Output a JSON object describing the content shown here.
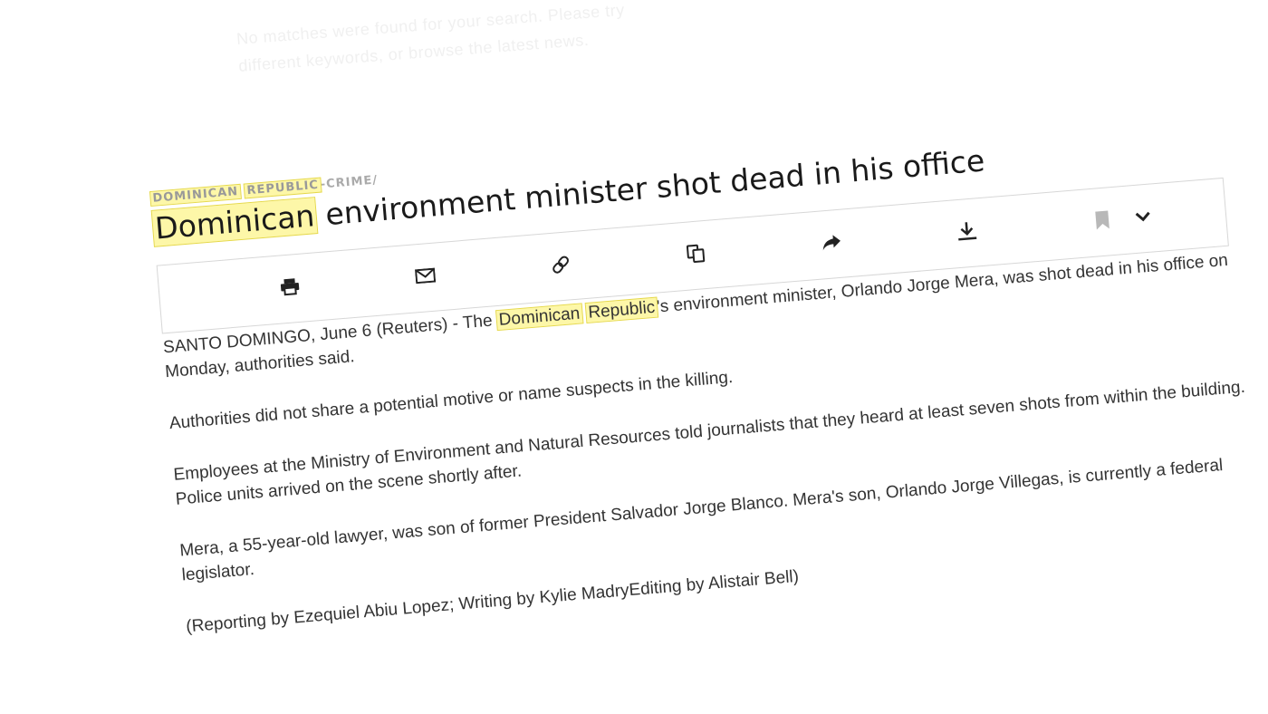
{
  "background_text": [
    "No matches were found for your search. Please try",
    "different keywords, or browse the latest news."
  ],
  "breadcrumb": {
    "part1": "DOMINICAN",
    "part2": "REPUBLIC",
    "rest": "-CRIME/"
  },
  "headline": {
    "highlighted": "Dominican",
    "rest": " environment minister shot dead in his office"
  },
  "toolbar": {
    "icons": [
      "print-icon",
      "mail-icon",
      "link-icon",
      "copy-icon",
      "share-icon",
      "download-icon",
      "bookmark-icon",
      "chevron-down-icon"
    ]
  },
  "article": {
    "lead_prefix": "SANTO DOMINGO, June 6 (Reuters) - The ",
    "lead_hl1": "Dominican",
    "lead_hl2": "Republic",
    "lead_suffix": "'s environment minister, Orlando Jorge Mera, was shot dead in his office on Monday, authorities said.",
    "p2": "Authorities did not share a potential motive or name suspects in the killing.",
    "p3": "Employees at the Ministry of Environment and Natural Resources told journalists that they heard at least seven shots from within the building. Police units arrived on the scene shortly after.",
    "p4": "Mera, a 55-year-old lawyer, was son of former President Salvador Jorge Blanco. Mera's son, Orlando Jorge Villegas, is currently a federal legislator.",
    "p5": "(Reporting by Ezequiel Abiu Lopez; Writing by Kylie MadryEditing by Alistair Bell)"
  },
  "colors": {
    "highlight_bg": "#fdf7a8",
    "highlight_border": "#e6d94a",
    "text": "#333333",
    "breadcrumb": "#aaaaaa"
  }
}
